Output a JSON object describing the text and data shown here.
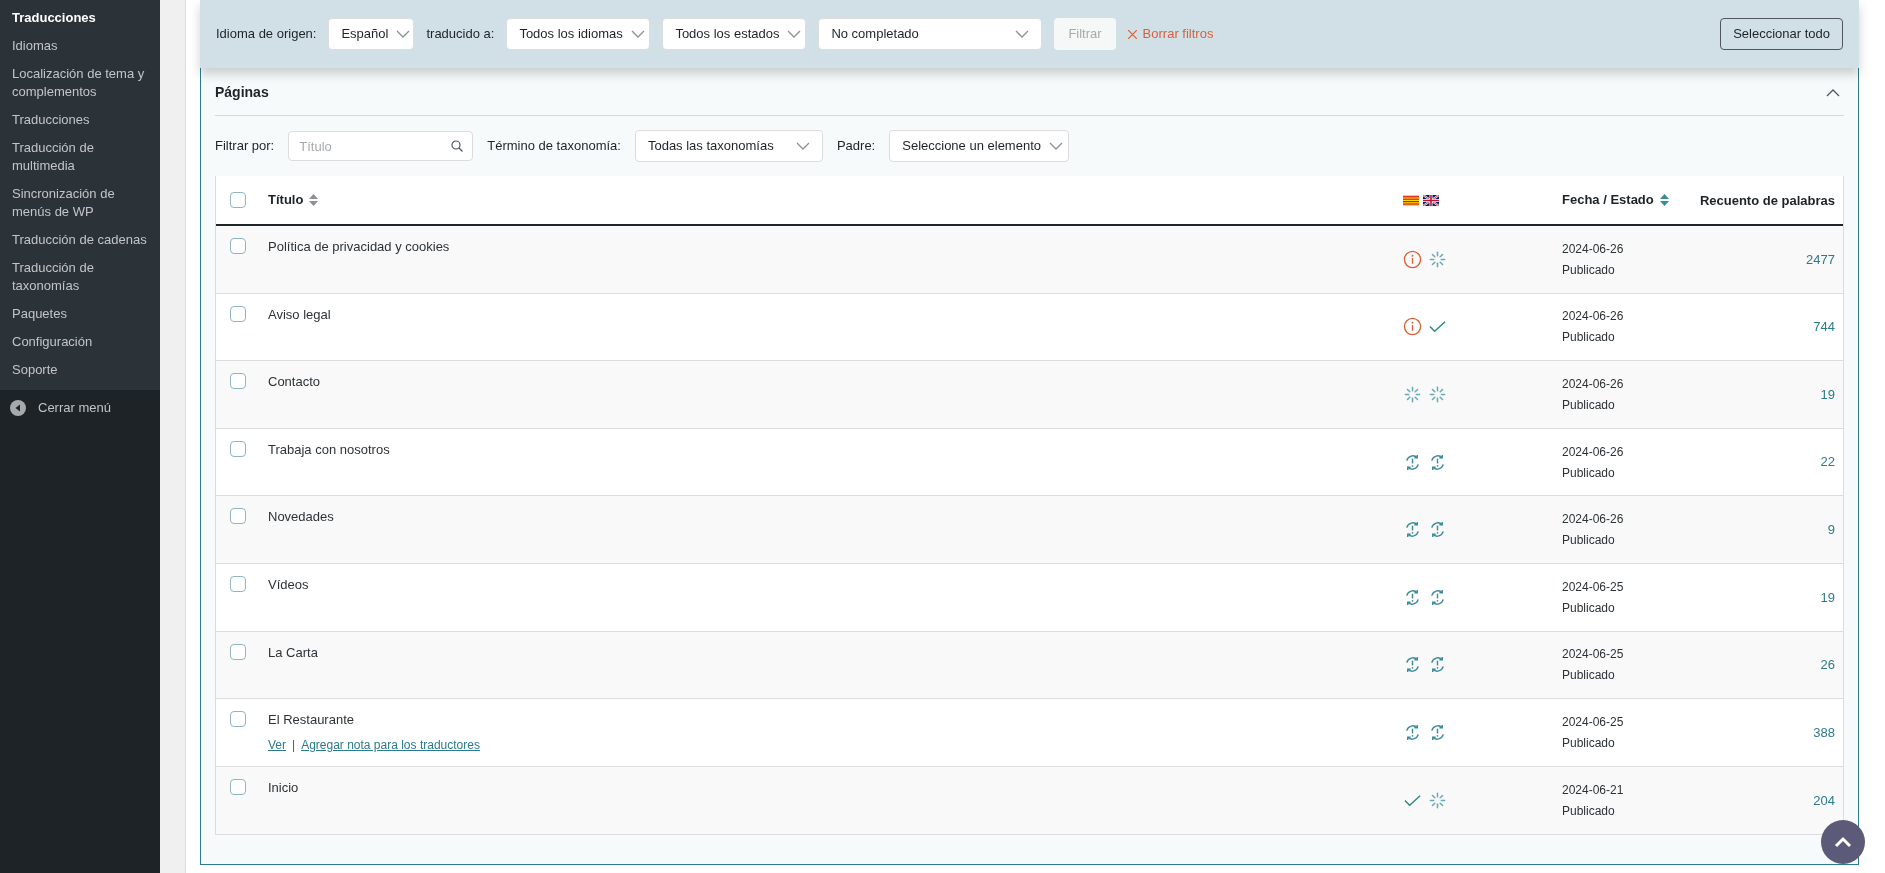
{
  "sidebar": {
    "items": [
      {
        "label": "Traducciones",
        "selected": true
      },
      {
        "label": "Idiomas",
        "selected": false
      },
      {
        "label": "Localización de tema y complementos",
        "selected": false
      },
      {
        "label": "Traducciones",
        "selected": false
      },
      {
        "label": "Traducción de multimedia",
        "selected": false
      },
      {
        "label": "Sincronización de menús de WP",
        "selected": false
      },
      {
        "label": "Traducción de cadenas",
        "selected": false
      },
      {
        "label": "Traducción de taxonomías",
        "selected": false
      },
      {
        "label": "Paquetes",
        "selected": false
      },
      {
        "label": "Configuración",
        "selected": false
      },
      {
        "label": "Soporte",
        "selected": false
      }
    ],
    "collapse": "Cerrar menú"
  },
  "filter_bar": {
    "source_label": "Idioma de origen:",
    "source": "Español",
    "target_label": "traducido a:",
    "target": "Todos los idiomas",
    "status": "Todos los estados",
    "completion": "No completado",
    "filter_button": {
      "label": "Filtrar",
      "disabled": true
    },
    "clear": "Borrar filtros",
    "select_all": "Seleccionar todo"
  },
  "panel": {
    "title": "Páginas",
    "expanded": true,
    "filters": {
      "filter_label": "Filtrar por:",
      "title_placeholder": "Título",
      "taxonomy_label": "Término de taxonomía:",
      "taxonomy": "Todas las taxonomías",
      "parent_label": "Padre:",
      "parent": "Seleccione un elemento"
    },
    "table": {
      "header_checked": false,
      "columns": [
        "Título",
        "Fecha / Estado",
        "Recuento de palabras"
      ],
      "rows": [
        {
          "checked": false,
          "title": "Política de privacidad y cookies",
          "status": [
            {
              "kind": "info"
            },
            {
              "kind": "spinner"
            }
          ],
          "date": "2024-06-26",
          "state": "Publicado",
          "words": "2477"
        },
        {
          "checked": false,
          "title": "Aviso legal",
          "status": [
            {
              "kind": "info"
            },
            {
              "kind": "check"
            }
          ],
          "date": "2024-06-26",
          "state": "Publicado",
          "words": "744"
        },
        {
          "checked": false,
          "title": "Contacto",
          "status": [
            {
              "kind": "spinner"
            },
            {
              "kind": "spinner"
            }
          ],
          "date": "2024-06-26",
          "state": "Publicado",
          "words": "19"
        },
        {
          "checked": false,
          "title": "Trabaja con nosotros",
          "status": [
            {
              "kind": "refresh"
            },
            {
              "kind": "refresh"
            }
          ],
          "date": "2024-06-26",
          "state": "Publicado",
          "words": "22"
        },
        {
          "checked": false,
          "title": "Novedades",
          "status": [
            {
              "kind": "refresh"
            },
            {
              "kind": "refresh"
            }
          ],
          "date": "2024-06-26",
          "state": "Publicado",
          "words": "9"
        },
        {
          "checked": false,
          "title": "Vídeos",
          "status": [
            {
              "kind": "refresh"
            },
            {
              "kind": "refresh"
            }
          ],
          "date": "2024-06-25",
          "state": "Publicado",
          "words": "19"
        },
        {
          "checked": false,
          "title": "La Carta",
          "status": [
            {
              "kind": "refresh"
            },
            {
              "kind": "refresh"
            }
          ],
          "date": "2024-06-25",
          "state": "Publicado",
          "words": "26"
        },
        {
          "checked": false,
          "title": "El Restaurante",
          "status": [
            {
              "kind": "refresh"
            },
            {
              "kind": "refresh"
            }
          ],
          "date": "2024-06-25",
          "state": "Publicado",
          "words": "388",
          "links": [
            "Ver",
            "Agregar nota para los traductores"
          ],
          "separator": "|"
        },
        {
          "checked": false,
          "title": "Inicio",
          "status": [
            {
              "kind": "check"
            },
            {
              "kind": "spinner"
            }
          ],
          "date": "2024-06-21",
          "state": "Publicado",
          "words": "204"
        }
      ]
    }
  }
}
